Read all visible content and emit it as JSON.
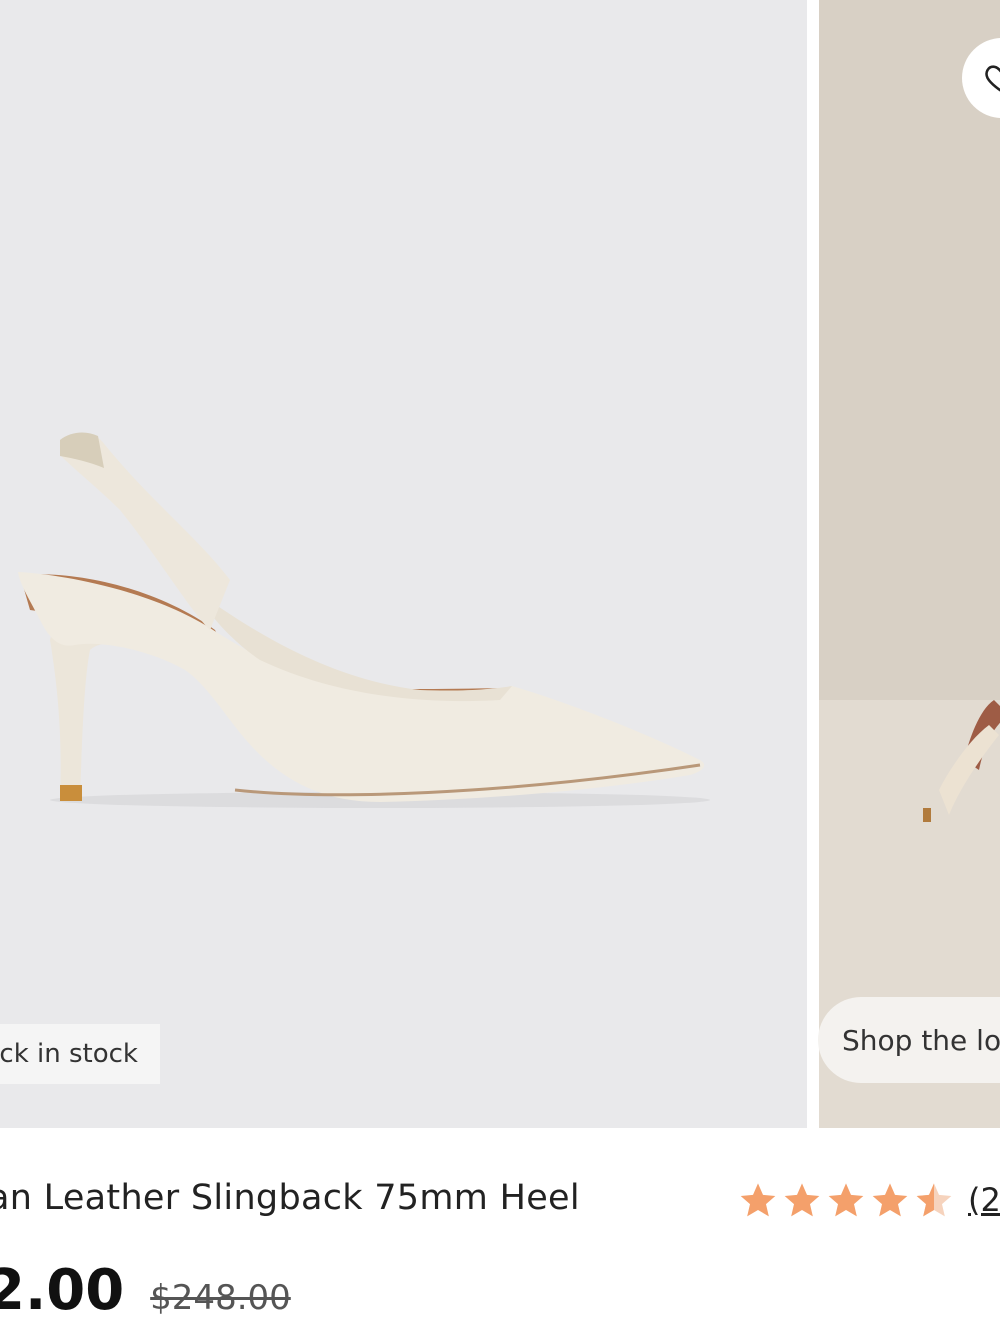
{
  "gallery": {
    "images": [
      {
        "alt": "main-product-image"
      },
      {
        "alt": "lifestyle-image"
      }
    ],
    "stock_badge": "ck in stock",
    "shop_the_look": "Shop the loo"
  },
  "product": {
    "title": "an Leather Slingback 75mm Heel",
    "rating": {
      "stars": 4.5,
      "max": 5,
      "count_text": "(2",
      "star_color": "#f4a06b"
    },
    "price_current": "2.00",
    "price_original": "$248.00"
  },
  "icons": {
    "wishlist": "heart-icon",
    "star": "star-icon"
  }
}
